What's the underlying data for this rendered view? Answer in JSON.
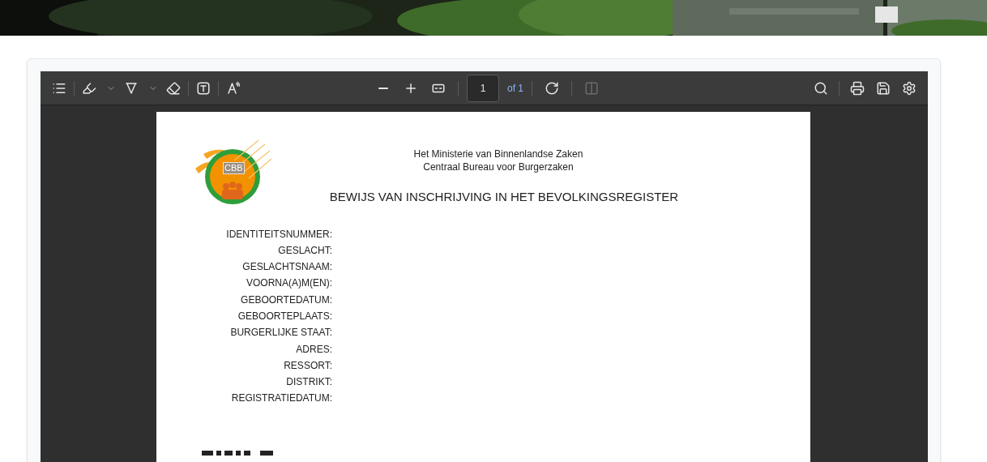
{
  "toolbar": {
    "left_tools": [
      {
        "kind": "outline",
        "disabled": false
      },
      {
        "kind": "highlight",
        "disabled": false,
        "menu": true
      },
      {
        "kind": "draw",
        "disabled": false,
        "menu": true
      },
      {
        "kind": "erase",
        "disabled": false
      },
      {
        "kind": "textbox",
        "disabled": false
      },
      {
        "kind": "read-aloud",
        "disabled": false
      }
    ],
    "center_tools": [
      {
        "kind": "zoom-out",
        "disabled": false
      },
      {
        "kind": "zoom-in",
        "disabled": false
      },
      {
        "kind": "fit",
        "disabled": false
      }
    ],
    "page_input": {
      "value": "1"
    },
    "page_count": "of 1",
    "after_page_tools": [
      {
        "kind": "rotate",
        "disabled": false
      },
      {
        "kind": "two-page",
        "disabled": true
      }
    ],
    "right_tools": [
      {
        "kind": "search",
        "disabled": false
      },
      {
        "kind": "print",
        "disabled": false
      },
      {
        "kind": "save",
        "disabled": false
      },
      {
        "kind": "settings",
        "disabled": false
      }
    ]
  },
  "document": {
    "logo_text": "CBB",
    "header_lines": [
      "Het Ministerie van Binnenlandse Zaken",
      "Centraal Bureau voor Burgerzaken"
    ],
    "title": "BEWIJS VAN INSCHRIJVING IN HET BEVOLKINGSREGISTER",
    "fields": [
      "IDENTITEITSNUMMER:",
      "GESLACHT:",
      "GESLACHTSNAAM:",
      "VOORNA(A)M(EN):",
      "GEBOORTEDATUM:",
      "GEBOORTEPLAATS:",
      "BURGERLIJKE STAAT:",
      "ADRES:",
      "RESSORT:",
      "DISTRIKT:",
      "REGISTRATIEDATUM:"
    ]
  }
}
